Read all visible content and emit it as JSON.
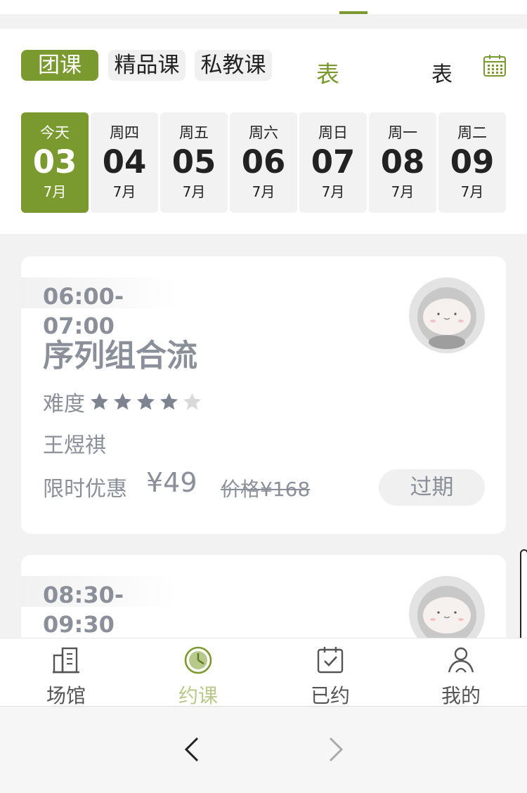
{
  "header": {
    "tabs": [
      "团课",
      "精品课",
      "私教课"
    ],
    "schedule_tab": "表",
    "clipped_tab": "表"
  },
  "days": [
    {
      "weekday": "今天",
      "day": "03",
      "month": "7月"
    },
    {
      "weekday": "周四",
      "day": "04",
      "month": "7月"
    },
    {
      "weekday": "周五",
      "day": "05",
      "month": "7月"
    },
    {
      "weekday": "周六",
      "day": "06",
      "month": "7月"
    },
    {
      "weekday": "周日",
      "day": "07",
      "month": "7月"
    },
    {
      "weekday": "周一",
      "day": "08",
      "month": "7月"
    },
    {
      "weekday": "周二",
      "day": "09",
      "month": "7月"
    }
  ],
  "courses": [
    {
      "time": "06:00-07:00",
      "title": "序列组合流",
      "difficulty_label": "难度",
      "rating": 4,
      "rating_max": 5,
      "coach": "王煜祺",
      "promo_label": "限时优惠",
      "promo_price": "¥49",
      "orig_price": "价格¥168",
      "status": "过期"
    },
    {
      "time": "08:30-09:30"
    }
  ],
  "nav": [
    "场馆",
    "约课",
    "已约",
    "我的"
  ],
  "colors": {
    "accent": "#7a9a30",
    "muted": "#8a8f99",
    "nav_active": "#b7c98a"
  }
}
